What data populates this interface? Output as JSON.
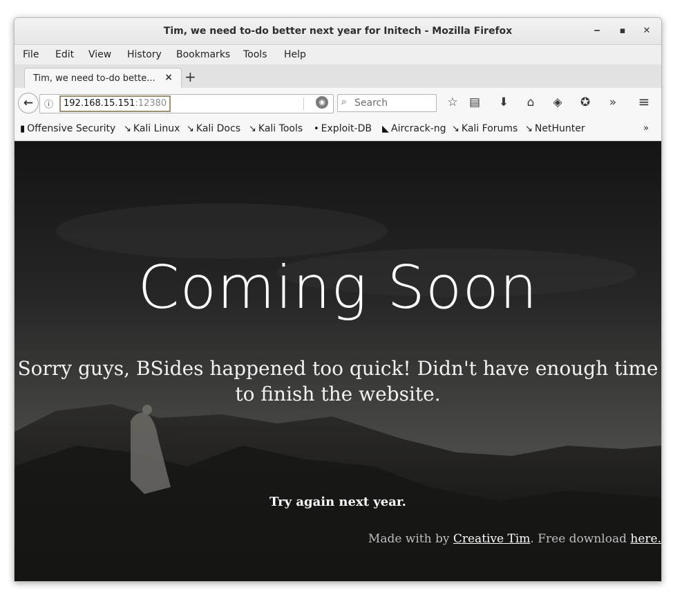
{
  "window": {
    "title": "Tim, we need to-do better next year for Initech - Mozilla Firefox",
    "minimize_glyph": "‒",
    "maximize_glyph": "▪",
    "close_glyph": "✕"
  },
  "menu": {
    "items": [
      "File",
      "Edit",
      "View",
      "History",
      "Bookmarks",
      "Tools",
      "Help"
    ]
  },
  "tabs": {
    "active_label": "Tim, we need to-do bette...",
    "close_glyph": "×",
    "new_tab_glyph": "+"
  },
  "nav": {
    "back_glyph": "←",
    "url_host": "192.168.15.151",
    "url_port": ":12380",
    "reload_glyph": "↻",
    "search_placeholder": "Search",
    "search_glyph": "⌕",
    "overflow_glyph": "»",
    "menu_glyph": "≡",
    "icons": [
      "star-icon",
      "reading-list-icon",
      "download-icon",
      "home-icon",
      "pocket-icon",
      "addon-icon"
    ]
  },
  "bookmarks": {
    "items": [
      "Offensive Security",
      "Kali Linux",
      "Kali Docs",
      "Kali Tools",
      "Exploit-DB",
      "Aircrack-ng",
      "Kali Forums",
      "NetHunter"
    ],
    "overflow_glyph": "»"
  },
  "page": {
    "heading": "Coming Soon",
    "subtitle": "Sorry guys, BSides happened too quick! Didn't have enough time to finish the website.",
    "cta": "Try again next year.",
    "credit_prefix": "Made with by ",
    "credit_link": "Creative Tim",
    "credit_middle": ". Free download ",
    "credit_here": "here."
  },
  "colors": {
    "page_background": "#2e2e2d",
    "heading": "#ffffff",
    "credit_text": "#bfbfbf"
  }
}
